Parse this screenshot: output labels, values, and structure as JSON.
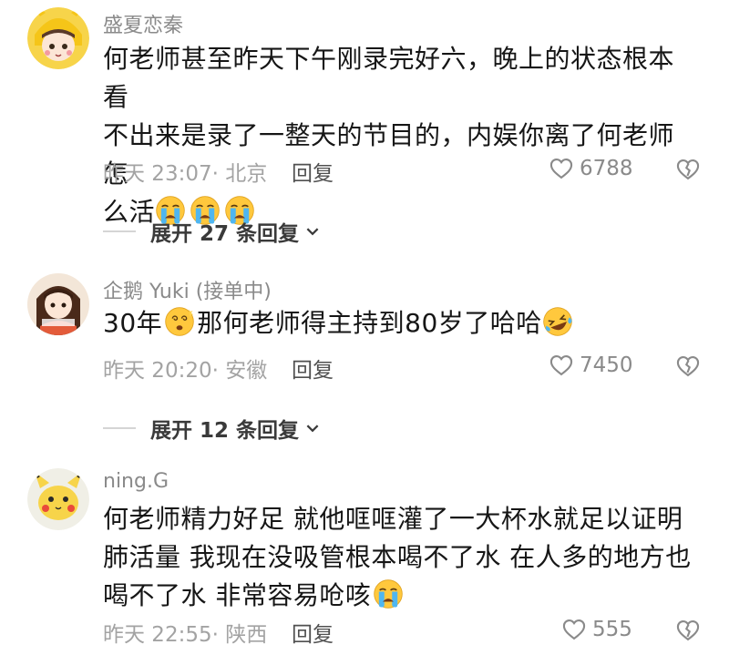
{
  "comments": [
    {
      "username": "盛夏恋秦",
      "lines": [
        "何老师甚至昨天下午刚录完好六，晚上的状态根本看",
        "不出来是录了一整天的节目的，内娱你离了何老师怎",
        "么活"
      ],
      "emoji_trail": [
        "crying-face-icon",
        "crying-face-icon",
        "crying-face-icon"
      ],
      "time_location": "昨天 23:07· 北京",
      "reply_label": "回复",
      "likes": "6788",
      "expand_label": "展开 27 条回复"
    },
    {
      "username": "企鹅 Yuki (接单中)",
      "text_a": "30年",
      "text_b": "那何老师得主持到80岁了哈哈",
      "time_location": "昨天 20:20· 安徽",
      "reply_label": "回复",
      "likes": "7450",
      "expand_label": "展开 12 条回复"
    },
    {
      "username": "ning.G",
      "lines": [
        "何老师精力好足  就他哐哐灌了一大杯水就足以证明",
        "肺活量  我现在没吸管根本喝不了水  在人多的地方也",
        "喝不了水  非常容易呛咳"
      ],
      "time_location": "昨天 22:55· 陕西",
      "reply_label": "回复",
      "likes": "555"
    }
  ]
}
